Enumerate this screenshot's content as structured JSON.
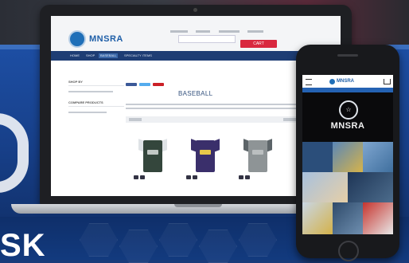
{
  "background": {
    "letters": "SK",
    "colors": {
      "blue": "#1d4ea3",
      "dark": "#2b2e36"
    }
  },
  "laptop_site": {
    "brand": "MNSRA",
    "cart_label": "CART",
    "nav_items": [
      "HOME",
      "SHOP",
      "BASEBALL",
      "SPECIALTY ITEMS"
    ],
    "sidebar_headings": [
      "SHOP BY",
      "COMPARE PRODUCTS"
    ],
    "category_title": "BASEBALL",
    "colors": {
      "nav": "#1e3d74",
      "cart": "#d9283f",
      "brand": "#1f5fa8"
    },
    "products": [
      {
        "color": "#34463c",
        "trim": "#dfe3e6"
      },
      {
        "color": "#3a2f6b",
        "trim": "#e7c84a"
      },
      {
        "color": "#8e9496",
        "trim": "#5c6468"
      }
    ]
  },
  "phone_site": {
    "brand": "MNSRA",
    "colors": {
      "header_bar": "#2462b3"
    },
    "tiles": [
      "#2b4e7a",
      "#5a87b8",
      "#7fa6d0",
      "#3f6f9e",
      "#a8c1de",
      "#1e3556",
      "#4c6c8c",
      "#c9d6e4",
      "#2e4a6a"
    ]
  }
}
